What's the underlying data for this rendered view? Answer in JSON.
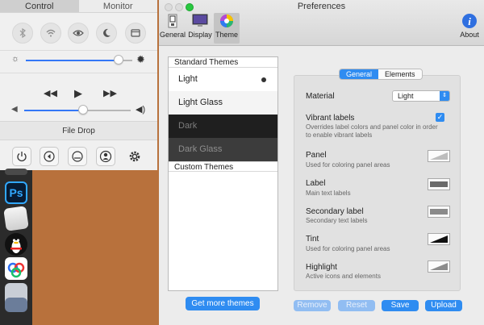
{
  "control_panel": {
    "tabs": [
      {
        "label": "Control",
        "active": true
      },
      {
        "label": "Monitor",
        "active": false
      }
    ],
    "file_drop_label": "File Drop"
  },
  "window": {
    "title": "Preferences",
    "toolbar": [
      {
        "label": "General",
        "icon": "general-icon"
      },
      {
        "label": "Display",
        "icon": "display-icon"
      },
      {
        "label": "Theme",
        "icon": "theme-icon",
        "selected": true
      }
    ],
    "about_label": "About"
  },
  "themes": {
    "standard_header": "Standard Themes",
    "items": [
      {
        "label": "Light",
        "selected": true
      },
      {
        "label": "Light Glass",
        "selected": false
      },
      {
        "label": "Dark",
        "selected": false
      },
      {
        "label": "Dark Glass",
        "selected": false
      }
    ],
    "custom_header": "Custom Themes",
    "get_more_label": "Get more themes"
  },
  "settings": {
    "tabs": [
      {
        "label": "General",
        "active": true
      },
      {
        "label": "Elements",
        "active": false
      }
    ],
    "material_label": "Material",
    "material_value": "Light",
    "vibrant_label": "Vibrant labels",
    "vibrant_checked": true,
    "vibrant_desc_line1": "Overrides label colors and panel color in order",
    "vibrant_desc_line2": "to enable vibrant labels",
    "panel_label": "Panel",
    "panel_desc": "Used for coloring panel areas",
    "label_label": "Label",
    "label_desc": "Main text labels",
    "secondary_label": "Secondary label",
    "secondary_desc": "Secondary text labels",
    "tint_label": "Tint",
    "tint_desc": "Used for coloring panel areas",
    "highlight_label": "Highlight",
    "highlight_desc": "Active icons and elements"
  },
  "actions": {
    "remove": "Remove",
    "reset": "Reset",
    "save": "Save",
    "upload": "Upload"
  },
  "colors": {
    "accent": "#2f8cf1",
    "dark_theme_bg": "#1f1f1f",
    "dark_glass_bg": "#3c3c3c"
  },
  "sliders": {
    "brightness_level": 0.87,
    "volume_level": 0.55
  }
}
